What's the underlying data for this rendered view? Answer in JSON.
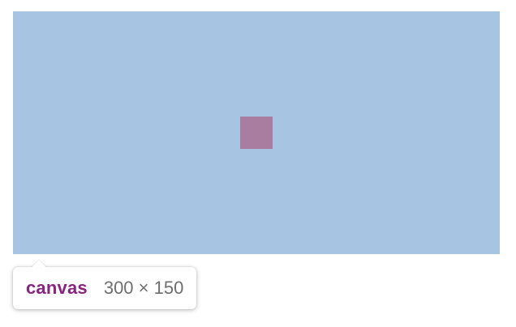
{
  "element": {
    "tag_name": "canvas",
    "dimensions": "300 × 150"
  },
  "colors": {
    "highlight_fill": "#a7c4e2",
    "square_fill": "#a87d9f",
    "tag_name_color": "#88237f",
    "dimensions_color": "#6e6e6e"
  }
}
